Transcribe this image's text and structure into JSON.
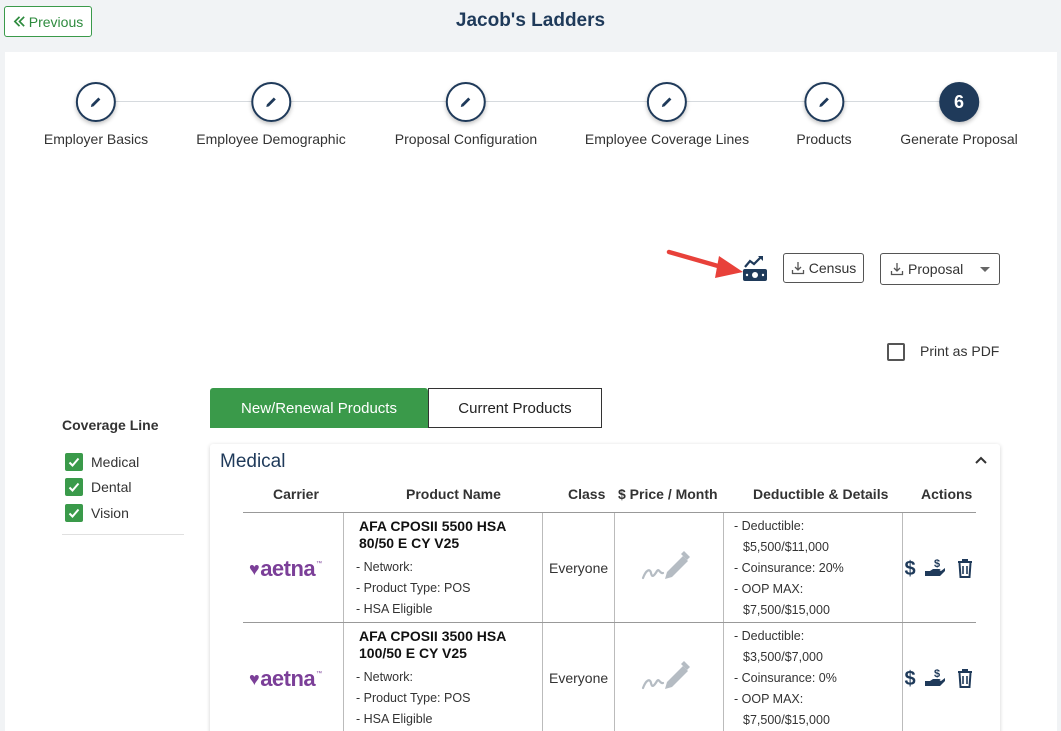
{
  "header": {
    "previous_label": "Previous",
    "title": "Jacob's Ladders"
  },
  "stepper": {
    "steps": [
      {
        "label": "Employer Basics",
        "state": "done"
      },
      {
        "label": "Employee Demographic",
        "state": "done"
      },
      {
        "label": "Proposal Configuration",
        "state": "done"
      },
      {
        "label": "Employee Coverage Lines",
        "state": "done"
      },
      {
        "label": "Products",
        "state": "done"
      },
      {
        "label": "Generate Proposal",
        "state": "active",
        "number": "6"
      }
    ]
  },
  "toolbar": {
    "money_icon": "money-chart-icon",
    "census_label": "Census",
    "proposal_label": "Proposal",
    "print_pdf_label": "Print as PDF"
  },
  "tabs": {
    "new_renewal": "New/Renewal Products",
    "current": "Current Products"
  },
  "sidebar": {
    "title": "Coverage Line",
    "items": [
      "Medical",
      "Dental",
      "Vision"
    ]
  },
  "section": {
    "title": "Medical",
    "columns": [
      "Carrier",
      "Product Name",
      "Class",
      "$ Price / Month",
      "Deductible & Details",
      "Actions"
    ],
    "rows": [
      {
        "carrier": "aetna",
        "product_name": "AFA CPOSII 5500 HSA 80/50 E CY V25",
        "details": [
          "- Network:",
          "- Product Type: POS",
          "- HSA Eligible"
        ],
        "class": "Everyone",
        "deductible": [
          "- Deductible:",
          "$5,500/$11,000",
          "- Coinsurance: 20%",
          "- OOP MAX:",
          "$7,500/$15,000"
        ]
      },
      {
        "carrier": "aetna",
        "product_name": "AFA CPOSII 3500 HSA 100/50 E CY V25",
        "details": [
          "- Network:",
          "- Product Type: POS",
          "- HSA Eligible"
        ],
        "class": "Everyone",
        "deductible": [
          "- Deductible:",
          "$3,500/$7,000",
          "- Coinsurance: 0%",
          "- OOP MAX:",
          "$7,500/$15,000"
        ]
      }
    ]
  },
  "colors": {
    "navy": "#1f3a5a",
    "green": "#3a9a4a",
    "aetna_purple": "#7b3f98",
    "arrow_red": "#e8413a"
  }
}
